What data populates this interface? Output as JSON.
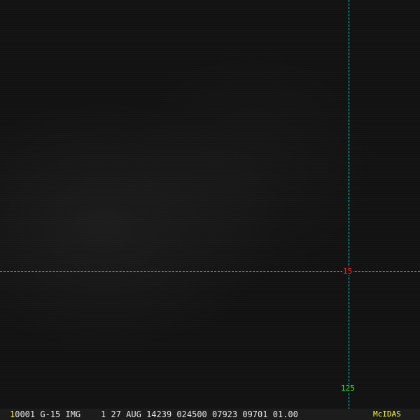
{
  "image": {
    "satellite": "G-15",
    "type": "IMG"
  },
  "overlay": {
    "latitude_label": "15",
    "longitude_label": "125",
    "grid_color": "#00e5e5",
    "latitude_color": "#ff2020",
    "longitude_color": "#20ff20"
  },
  "status_bar": {
    "frame": "1",
    "info": "0001 G-15 IMG    1 27 AUG 14239 024500 07923 09701 01.00",
    "brand": "McIDAS",
    "brand_color": "#ffff20"
  }
}
